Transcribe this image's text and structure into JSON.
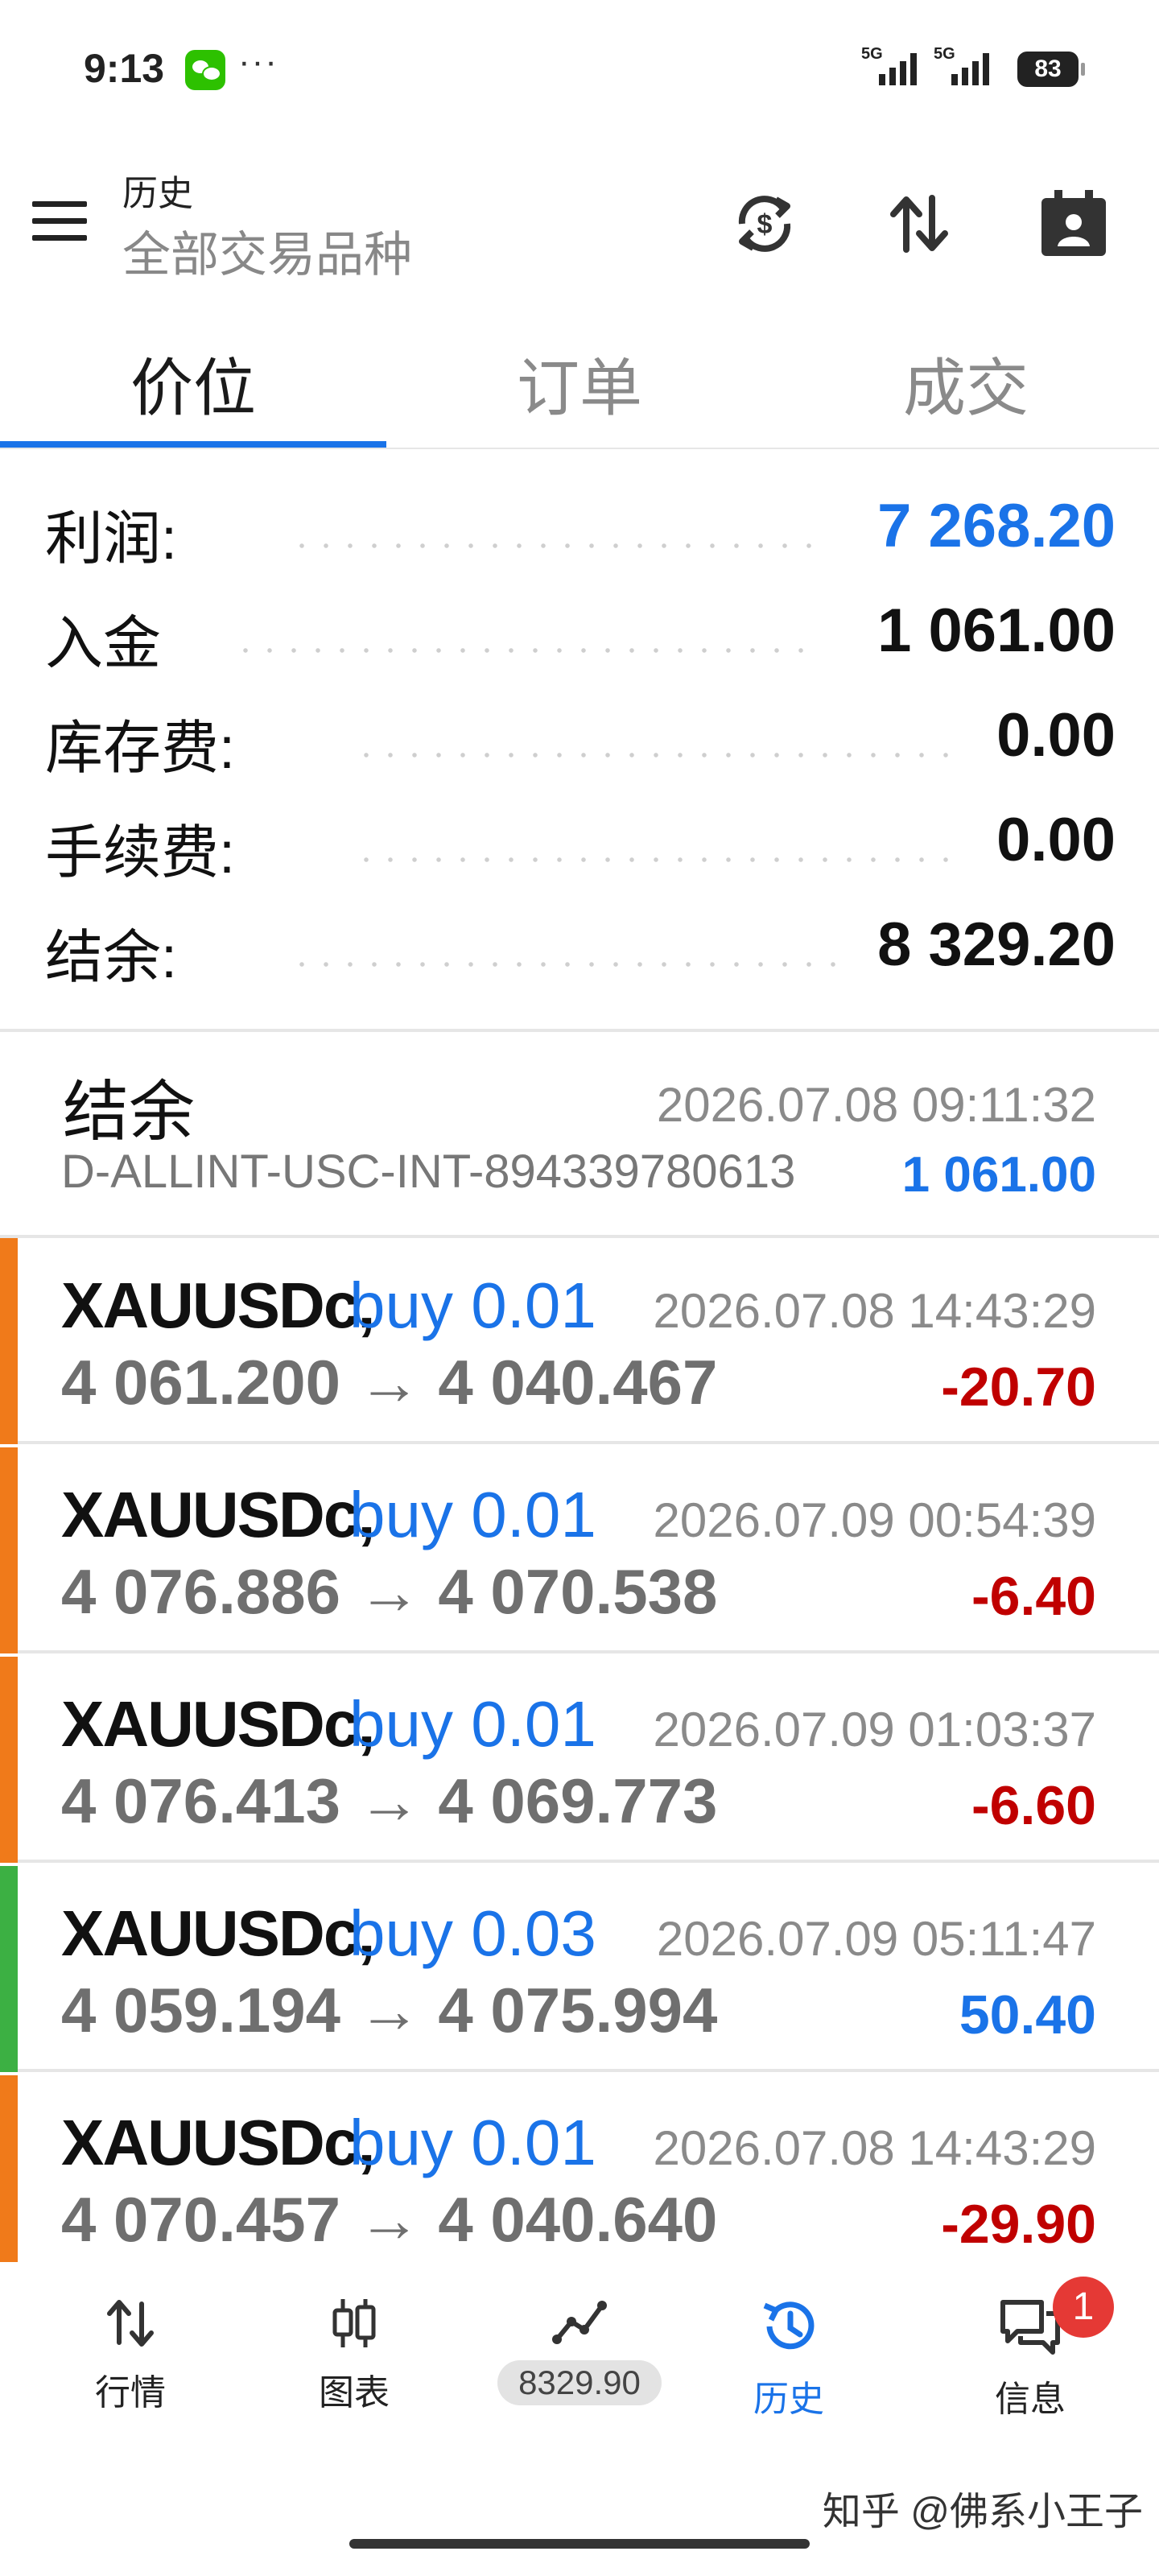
{
  "status_bar": {
    "time": "9:13",
    "more": "···",
    "signal1": "5G",
    "signal2": "5G",
    "battery": "83"
  },
  "header": {
    "title": "历史",
    "subtitle": "全部交易品种",
    "icons": [
      "currency-exchange-icon",
      "sort-icon",
      "calendar-icon"
    ]
  },
  "tabs": [
    {
      "label": "价位",
      "active": true
    },
    {
      "label": "订单",
      "active": false
    },
    {
      "label": "成交",
      "active": false
    }
  ],
  "summary": [
    {
      "label": "利润:",
      "value": "7 268.20",
      "color": "#1a73e8"
    },
    {
      "label": "入金",
      "value": "1 061.00"
    },
    {
      "label": "库存费:",
      "value": "0.00"
    },
    {
      "label": "手续费:",
      "value": "0.00"
    },
    {
      "label": "结余:",
      "value": "8 329.20"
    }
  ],
  "balance_entry": {
    "title": "结余",
    "account": "D-ALLINT-USC-INT-894339780613",
    "time": "2026.07.08 09:11:32",
    "amount": "1 061.00"
  },
  "entries": [
    {
      "symbol": "XAUUSDc,",
      "action": "buy 0.01",
      "time": "2026.07.08 14:43:29",
      "prices": "4 061.200 → 4 040.467",
      "profit": "-20.70",
      "bar_color": "#f07a1a"
    },
    {
      "symbol": "XAUUSDc,",
      "action": "buy 0.01",
      "time": "2026.07.09 00:54:39",
      "prices": "4 076.886 → 4 070.538",
      "profit": "-6.40",
      "bar_color": "#f07a1a"
    },
    {
      "symbol": "XAUUSDc,",
      "action": "buy 0.01",
      "time": "2026.07.09 01:03:37",
      "prices": "4 076.413 → 4 069.773",
      "profit": "-6.60",
      "bar_color": "#f07a1a"
    },
    {
      "symbol": "XAUUSDc,",
      "action": "buy 0.03",
      "time": "2026.07.09 05:11:47",
      "prices": "4 059.194 → 4 075.994",
      "profit": "50.40",
      "bar_color": "#3cb043"
    },
    {
      "symbol": "XAUUSDc,",
      "action": "buy 0.01",
      "time": "2026.07.08 14:43:29",
      "prices": "4 070.457 → 4 040.640",
      "profit": "-29.90",
      "bar_color": "#f07a1a"
    }
  ],
  "bottom_nav": [
    {
      "label": "行情",
      "icon": "quotes-icon"
    },
    {
      "label": "图表",
      "icon": "chart-icon"
    },
    {
      "label": "8329.90",
      "icon": "trade-icon"
    },
    {
      "label": "历史",
      "icon": "history-icon",
      "active": true
    },
    {
      "label": "信息",
      "icon": "messages-icon",
      "badge": "1"
    }
  ],
  "watermark": "知乎 @佛系小王子"
}
